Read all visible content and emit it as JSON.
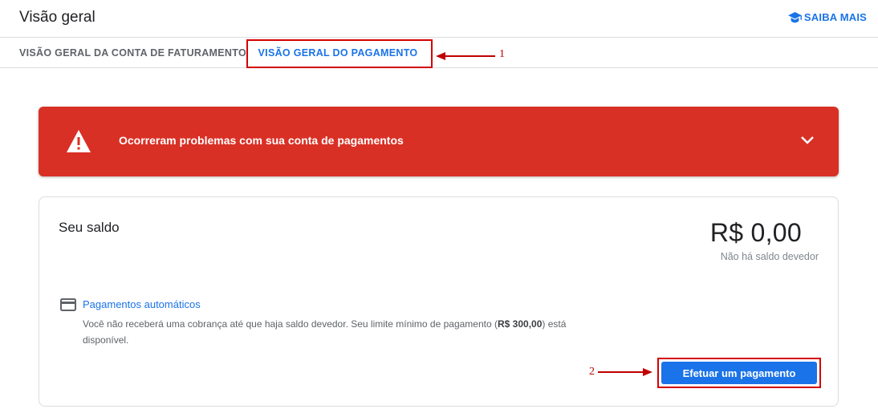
{
  "header": {
    "title": "Visão geral",
    "learn_more": "SAIBA MAIS"
  },
  "tabs": [
    {
      "label": "VISÃO GERAL DA CONTA DE FATURAMENTO",
      "active": false
    },
    {
      "label": "VISÃO GERAL DO PAGAMENTO",
      "active": true
    }
  ],
  "annotations": {
    "first": "1",
    "second": "2"
  },
  "alert": {
    "message": "Ocorreram problemas com sua conta de pagamentos",
    "icon": "warning-icon",
    "color": "#d93025"
  },
  "balance": {
    "label": "Seu saldo",
    "amount": "R$ 0,00",
    "status": "Não há saldo devedor"
  },
  "autopay": {
    "icon": "credit-card-icon",
    "link": "Pagamentos automáticos",
    "desc_before": "Você não receberá uma cobrança até que haja saldo devedor. Seu limite mínimo de pagamento (",
    "min_amount": "R$ 300,00",
    "desc_after": ") está disponível."
  },
  "actions": {
    "pay_button": "Efetuar um pagamento"
  },
  "colors": {
    "accent": "#1a73e8",
    "annotation": "#d30000"
  }
}
